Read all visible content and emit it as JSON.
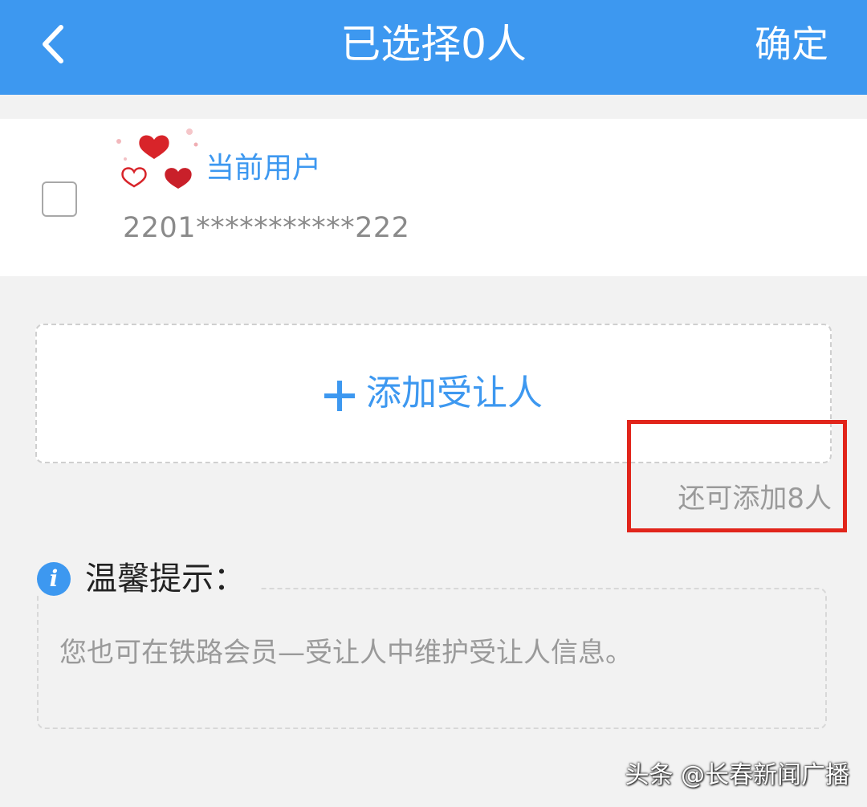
{
  "header": {
    "back_icon": "chevron-left-icon",
    "title": "已选择0人",
    "confirm_label": "确定"
  },
  "current_user": {
    "label": "当前用户",
    "id_number": "2201***********222",
    "checked": false,
    "avatar_icon": "hearts-sticker-icon"
  },
  "add_passenger": {
    "label": "添加受让人",
    "icon": "plus-icon"
  },
  "remaining": {
    "text": "还可添加8人"
  },
  "tip": {
    "icon": "info-icon",
    "icon_glyph": "i",
    "title": "温馨提示：",
    "text": "您也可在铁路会员—受让人中维护受让人信息。"
  },
  "watermark": {
    "text": "头条 @长春新闻广播"
  },
  "colors": {
    "primary": "#3d98f0",
    "background": "#f2f2f2",
    "highlight": "#e1251b"
  }
}
